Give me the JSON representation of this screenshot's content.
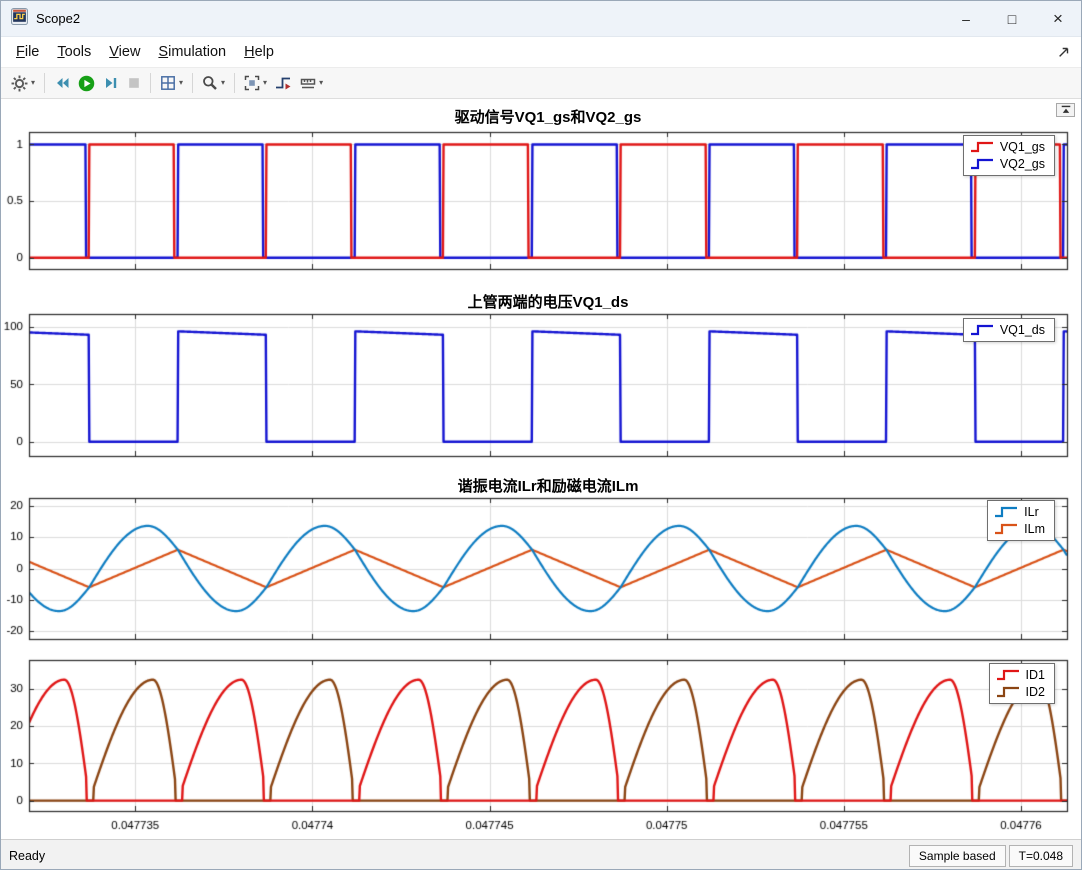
{
  "window": {
    "title": "Scope2",
    "controls": {
      "minimize": "–",
      "maximize": "□",
      "close": "×"
    }
  },
  "menu": {
    "items": [
      {
        "mnemonic": "F",
        "rest": "ile"
      },
      {
        "mnemonic": "T",
        "rest": "ools"
      },
      {
        "mnemonic": "V",
        "rest": "iew"
      },
      {
        "mnemonic": "S",
        "rest": "imulation"
      },
      {
        "mnemonic": "H",
        "rest": "elp"
      }
    ]
  },
  "toolbar": {
    "buttons": [
      {
        "name": "settings",
        "icon": "gear",
        "dropdown": true
      },
      {
        "separator": true
      },
      {
        "name": "step-back",
        "icon": "step-back"
      },
      {
        "name": "run",
        "icon": "run"
      },
      {
        "name": "step-forward",
        "icon": "step-forward"
      },
      {
        "name": "stop",
        "icon": "stop",
        "disabled": true
      },
      {
        "separator": true
      },
      {
        "name": "layout",
        "icon": "layout",
        "dropdown": true
      },
      {
        "separator": true
      },
      {
        "name": "zoom",
        "icon": "zoom",
        "dropdown": true
      },
      {
        "separator": true
      },
      {
        "name": "fit-to-view",
        "icon": "fit",
        "dropdown": true
      },
      {
        "name": "trigger",
        "icon": "trigger"
      },
      {
        "name": "measurements",
        "icon": "measure",
        "dropdown": true
      }
    ]
  },
  "statusbar": {
    "status": "Ready",
    "sample_mode": "Sample based",
    "time": "T=0.048"
  },
  "xaxis": {
    "xlim": [
      0.047732,
      0.0477613
    ],
    "ticks": [
      0.047735,
      0.04774,
      0.047745,
      0.04775,
      0.047755,
      0.04776
    ],
    "labels": [
      "0.047735",
      "0.04774",
      "0.047745",
      "0.04775",
      "0.047755",
      "0.04776"
    ]
  },
  "chart_data": [
    {
      "type": "line",
      "title": "驱动信号VQ1_gs和VQ2_gs",
      "ylim": [
        -0.1,
        1.11
      ],
      "yticks": [
        0,
        0.5,
        1
      ],
      "ytick_labels": [
        "0",
        "0.5",
        "1"
      ],
      "legend": [
        "VQ1_gs",
        "VQ2_gs"
      ],
      "series": [
        {
          "name": "VQ1_gs",
          "color": "#e01616",
          "width": 2.4,
          "gen": "gate",
          "params": {
            "t_ref": 0.0477312,
            "period": 5e-06,
            "on_start": 2.5e-06,
            "on_end": 4.9e-06,
            "high": 1,
            "low": 0
          }
        },
        {
          "name": "VQ2_gs",
          "color": "#1414d2",
          "width": 2.4,
          "gen": "gate",
          "params": {
            "t_ref": 0.0477312,
            "period": 5e-06,
            "on_start": 0,
            "on_end": 2.4e-06,
            "high": 1,
            "low": 0
          }
        }
      ]
    },
    {
      "type": "line",
      "title": "上管两端的电压VQ1_ds",
      "ylim": [
        -12,
        111
      ],
      "yticks": [
        0,
        50,
        100
      ],
      "ytick_labels": [
        "0",
        "50",
        "100"
      ],
      "legend": [
        "VQ1_ds"
      ],
      "series": [
        {
          "name": "VQ1_ds",
          "color": "#1414d2",
          "width": 2.4,
          "gen": "vds",
          "params": {
            "t_ref": 0.0477312,
            "period": 5e-06,
            "half": 2.5e-06,
            "v_start": 96,
            "v_end": 93,
            "v_low": 0.4
          }
        }
      ]
    },
    {
      "type": "line",
      "title": "谐振电流ILr和励磁电流ILm",
      "ylim": [
        -22.5,
        22.5
      ],
      "yticks": [
        -20,
        -10,
        0,
        10,
        20
      ],
      "ytick_labels": [
        "-20",
        "-10",
        "0",
        "10",
        "20"
      ],
      "legend": [
        "ILr",
        "ILm"
      ],
      "series": [
        {
          "name": "ILr",
          "color": "#0e7dc2",
          "width": 2.2,
          "gen": "ilr",
          "params": {
            "t_ref": 0.0477312,
            "period": 5e-06,
            "peak": 13.6,
            "sw": 6,
            "skew": 0.66
          }
        },
        {
          "name": "ILm",
          "color": "#d95319",
          "width": 2.2,
          "gen": "ilm",
          "params": {
            "t_ref": 0.0477312,
            "period": 5e-06,
            "amp": 6
          }
        }
      ]
    },
    {
      "type": "line",
      "title": "",
      "ylim": [
        -2.8,
        37.8
      ],
      "yticks": [
        0,
        10,
        20,
        30
      ],
      "ytick_labels": [
        "0",
        "10",
        "20",
        "30"
      ],
      "legend": [
        "ID1",
        "ID2"
      ],
      "series": [
        {
          "name": "ID1",
          "color": "#e01616",
          "width": 2.4,
          "gen": "diode",
          "params": {
            "t_ref": 0.0477312,
            "period": 5e-06,
            "peak": 32.5,
            "skew": 0.72,
            "phase": "first"
          }
        },
        {
          "name": "ID2",
          "color": "#8b4513",
          "width": 2.4,
          "gen": "diode",
          "params": {
            "t_ref": 0.0477312,
            "period": 5e-06,
            "peak": 32.5,
            "skew": 0.72,
            "phase": "second"
          }
        }
      ]
    }
  ]
}
